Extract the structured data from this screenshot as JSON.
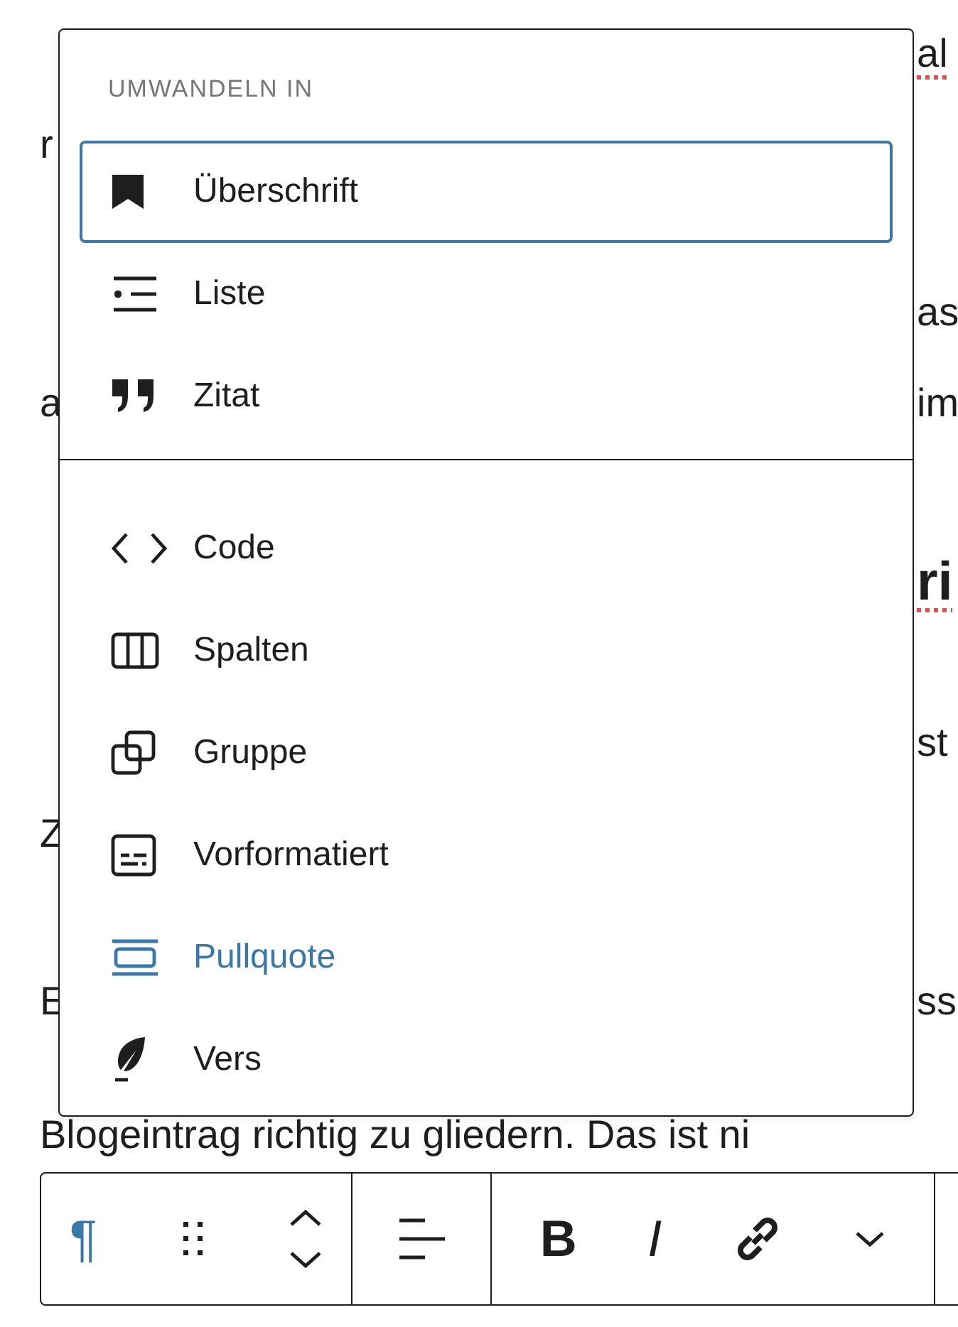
{
  "document": [
    {
      "kind": "paragraph",
      "lines": [
        {
          "right": "al",
          "right_misspelled": true
        },
        {
          "left": "r"
        }
      ]
    },
    {
      "kind": "paragraph",
      "lines": [
        {
          "right": "as",
          "right_misspelled": false
        },
        {
          "left": "a",
          "right": "im",
          "right_misspelled": false
        }
      ]
    },
    {
      "kind": "heading",
      "lines": [
        {
          "right": "ri",
          "right_misspelled": true
        }
      ]
    },
    {
      "kind": "paragraph",
      "lines": [
        {
          "right": "st",
          "right_misspelled": false
        },
        {
          "left": "Z"
        }
      ]
    },
    {
      "kind": "paragraph",
      "lines": [
        {
          "left": "E",
          "right": "ss",
          "right_misspelled": false
        },
        {
          "text": "Blogeintrag richtig zu gliedern. Das ist ni"
        }
      ]
    }
  ],
  "transform_menu": {
    "title": "UMWANDELN IN",
    "groups": [
      [
        {
          "kind": "heading",
          "label": "Überschrift",
          "selected": true,
          "highlighted": false
        },
        {
          "kind": "list",
          "label": "Liste",
          "selected": false,
          "highlighted": false
        },
        {
          "kind": "quote",
          "label": "Zitat",
          "selected": false,
          "highlighted": false
        }
      ],
      [
        {
          "kind": "code",
          "label": "Code",
          "selected": false,
          "highlighted": false
        },
        {
          "kind": "columns",
          "label": "Spalten",
          "selected": false,
          "highlighted": false
        },
        {
          "kind": "group",
          "label": "Gruppe",
          "selected": false,
          "highlighted": false
        },
        {
          "kind": "preformatted",
          "label": "Vorformatiert",
          "selected": false,
          "highlighted": false
        },
        {
          "kind": "pullquote",
          "label": "Pullquote",
          "selected": false,
          "highlighted": true
        },
        {
          "kind": "verse",
          "label": "Vers",
          "selected": false,
          "highlighted": false
        }
      ]
    ]
  },
  "toolbar": {
    "groups": [
      [
        {
          "kind": "paragraph",
          "glyph": "¶",
          "active": true
        },
        {
          "kind": "drag"
        },
        {
          "kind": "move"
        }
      ],
      [
        {
          "kind": "align"
        }
      ],
      [
        {
          "kind": "bold",
          "glyph": "B"
        },
        {
          "kind": "italic",
          "glyph": "I"
        },
        {
          "kind": "link"
        },
        {
          "kind": "more"
        }
      ]
    ]
  }
}
